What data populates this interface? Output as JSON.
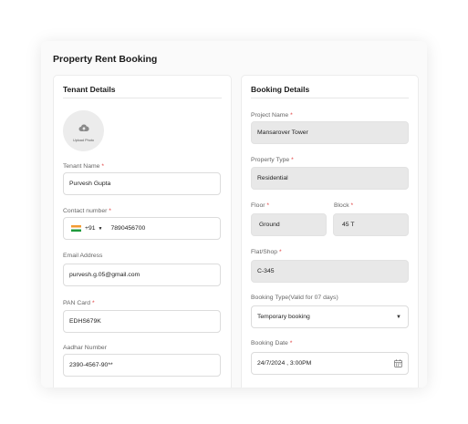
{
  "page": {
    "title": "Property Rent Booking"
  },
  "tenant": {
    "heading": "Tenant Details",
    "upload_label": "Upload Photo",
    "name_label": "Tenant Name",
    "name_value": "Purvesh Gupta",
    "contact_label": "Contact number",
    "country_code": "+91",
    "phone_value": "7890456700",
    "email_label": "Email Address",
    "email_value": "purvesh.g.05@gmail.com",
    "pan_label": "PAN Card",
    "pan_value": "EDHS679K",
    "aadhar_label": "Aadhar Number",
    "aadhar_value": "2390-4567-90**"
  },
  "booking": {
    "heading": "Booking Details",
    "project_label": "Project Name",
    "project_value": "Mansarover Tower",
    "type_label": "Property Type",
    "type_value": "Residential",
    "floor_label": "Floor",
    "floor_value": "Ground",
    "block_label": "Block",
    "block_value": "45 T",
    "flat_label": "Flat/Shop",
    "flat_value": "C-345",
    "booking_type_label": "Booking Type(Valid for 07 days)",
    "booking_type_value": "Temporary booking",
    "date_label": "Booking Date",
    "date_value": "24/7/2024 , 3:00PM"
  },
  "icons": {
    "upload": "cloud-upload-icon",
    "flag": "india-flag-icon",
    "dropdown": "chevron-down-icon",
    "calendar": "calendar-icon"
  },
  "colors": {
    "required": "#e03b3b",
    "filled_bg": "#e8e8e8"
  }
}
